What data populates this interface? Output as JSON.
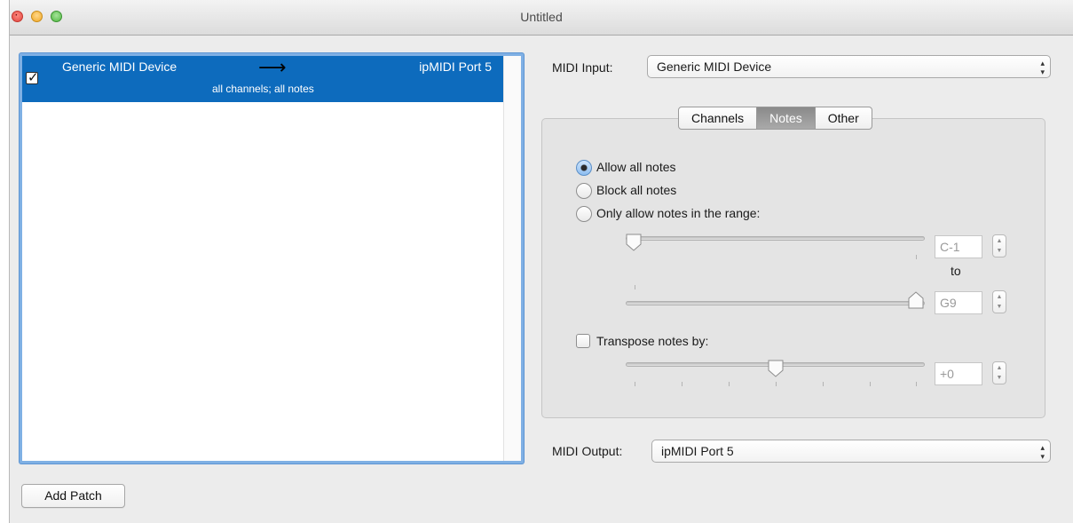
{
  "window": {
    "title": "Untitled"
  },
  "patch_list": {
    "rows": [
      {
        "source": "Generic MIDI Device",
        "destination": "ipMIDI Port 5",
        "description": "all channels; all notes",
        "checked": true
      }
    ]
  },
  "buttons": {
    "add_patch": "Add Patch"
  },
  "midi_input": {
    "label": "MIDI Input:",
    "value": "Generic MIDI Device"
  },
  "midi_output": {
    "label": "MIDI Output:",
    "value": "ipMIDI Port 5"
  },
  "tabs": [
    {
      "label": "Channels",
      "active": false
    },
    {
      "label": "Notes",
      "active": true
    },
    {
      "label": "Other",
      "active": false
    }
  ],
  "notes": {
    "allow_all": "Allow all notes",
    "block_all": "Block all notes",
    "range": "Only allow notes in the range:",
    "selected": "allow_all",
    "range_low": "C-1",
    "range_to": "to",
    "range_high": "G9",
    "transpose_label": "Transpose notes by:",
    "transpose_checked": false,
    "transpose_value": "+0"
  },
  "colors": {
    "selection_blue": "#0d6bbd",
    "focus_ring": "#7fb0e4",
    "active_tab": "#9a9a9a"
  }
}
